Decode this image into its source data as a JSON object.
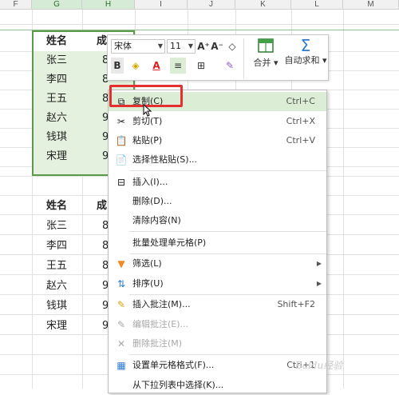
{
  "columns": [
    "F",
    "G",
    "H",
    "I",
    "J",
    "K",
    "L",
    "M"
  ],
  "table1": {
    "header": [
      "姓名",
      "成"
    ],
    "names": [
      "张三",
      "李四",
      "王五",
      "赵六",
      "钱琪",
      "宋理"
    ],
    "scores": [
      "8",
      "8",
      "8",
      "9",
      "9",
      "9"
    ]
  },
  "table2": {
    "header": [
      "姓名",
      "成"
    ],
    "names": [
      "张三",
      "李四",
      "王五",
      "赵六",
      "钱琪",
      "宋理"
    ],
    "scores": [
      "8",
      "8",
      "8",
      "9",
      "9",
      "9"
    ]
  },
  "toolbar": {
    "font_name": "宋体",
    "font_size": "11",
    "grow_font": "A⁺",
    "shrink_font": "A⁻",
    "clear_format": "◇",
    "bold": "B",
    "fill_color": "◈",
    "font_color": "A",
    "align": "≡",
    "border": "⊞",
    "format_painter": "✎",
    "merge_label": "合并",
    "autosum_label": "自动求和",
    "accent_color": "#2e7bcf"
  },
  "menu": {
    "items": [
      {
        "label": "复制(C)",
        "shortcut": "Ctrl+C",
        "icon": "copy-icon",
        "glyph": "⧉"
      },
      {
        "label": "剪切(T)",
        "shortcut": "Ctrl+X",
        "icon": "cut-icon",
        "glyph": "✂"
      },
      {
        "label": "粘贴(P)",
        "shortcut": "Ctrl+V",
        "icon": "paste-icon",
        "glyph": "📋"
      },
      {
        "label": "选择性粘贴(S)...",
        "shortcut": "",
        "icon": "paste-special-icon",
        "glyph": "📄"
      },
      {
        "label": "插入(I)...",
        "shortcut": "",
        "icon": "insert-icon",
        "glyph": "⊟"
      },
      {
        "label": "删除(D)...",
        "shortcut": "",
        "icon": "",
        "glyph": ""
      },
      {
        "label": "清除内容(N)",
        "shortcut": "",
        "icon": "",
        "glyph": ""
      },
      {
        "label": "批量处理单元格(P)",
        "shortcut": "",
        "icon": "",
        "glyph": ""
      },
      {
        "label": "筛选(L)",
        "shortcut": "",
        "icon": "filter-icon",
        "glyph": "▼"
      },
      {
        "label": "排序(U)",
        "shortcut": "",
        "icon": "sort-icon",
        "glyph": "⇅"
      },
      {
        "label": "插入批注(M)...",
        "shortcut": "Shift+F2",
        "icon": "insert-comment-icon",
        "glyph": "✎"
      },
      {
        "label": "编辑批注(E)...",
        "shortcut": "",
        "icon": "edit-comment-icon",
        "glyph": "✎"
      },
      {
        "label": "删除批注(M)",
        "shortcut": "",
        "icon": "delete-comment-icon",
        "glyph": "✕"
      },
      {
        "label": "设置单元格格式(F)...",
        "shortcut": "Ctrl+1",
        "icon": "format-cells-icon",
        "glyph": "▦"
      },
      {
        "label": "从下拉列表中选择(K)...",
        "shortcut": "",
        "icon": "",
        "glyph": ""
      }
    ]
  },
  "watermark": "Baidu经验"
}
